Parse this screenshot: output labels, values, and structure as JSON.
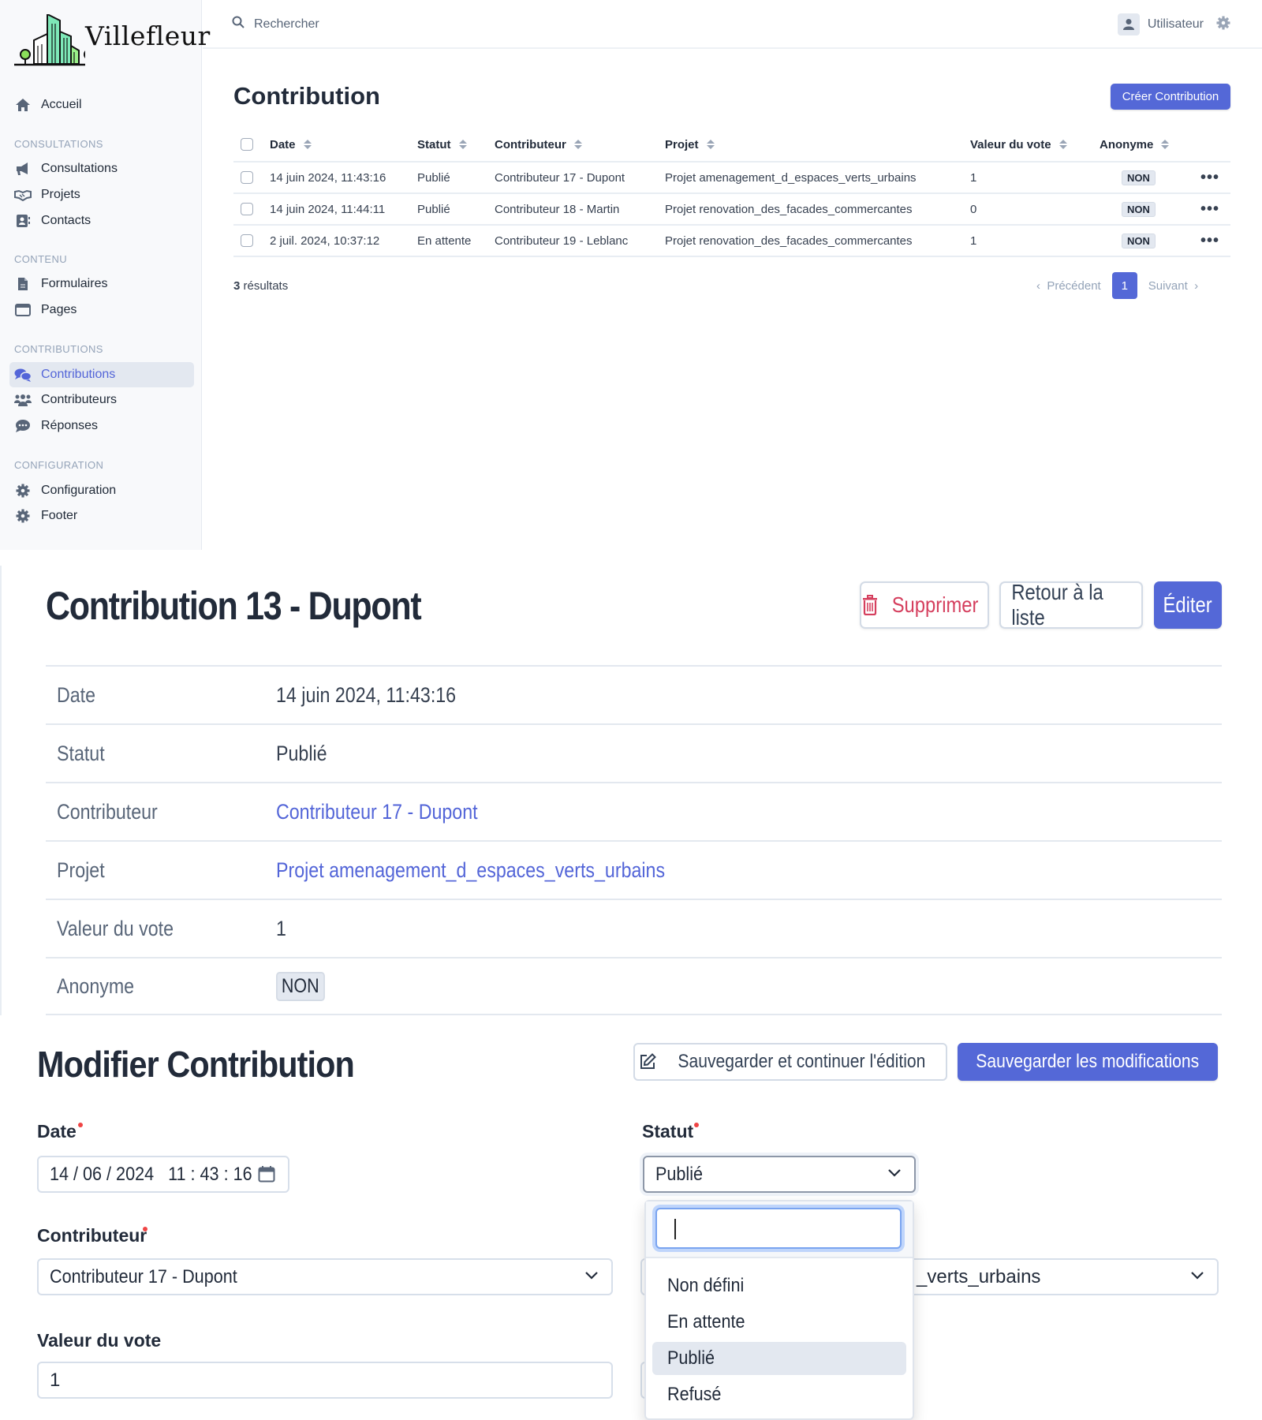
{
  "app": {
    "brand": "Villefleur",
    "search_placeholder": "Rechercher",
    "user_label": "Utilisateur"
  },
  "sidebar": {
    "home": {
      "label": "Accueil",
      "icon": "home-icon"
    },
    "sections": [
      {
        "title": "CONSULTATIONS",
        "items": [
          {
            "label": "Consultations",
            "icon": "megaphone-icon"
          },
          {
            "label": "Projets",
            "icon": "handshake-icon"
          },
          {
            "label": "Contacts",
            "icon": "address-book-icon"
          }
        ]
      },
      {
        "title": "CONTENU",
        "items": [
          {
            "label": "Formulaires",
            "icon": "file-icon"
          },
          {
            "label": "Pages",
            "icon": "window-icon"
          }
        ]
      },
      {
        "title": "CONTRIBUTIONS",
        "items": [
          {
            "label": "Contributions",
            "icon": "comments-icon",
            "active": true
          },
          {
            "label": "Contributeurs",
            "icon": "users-icon"
          },
          {
            "label": "Réponses",
            "icon": "comment-dots-icon"
          }
        ]
      },
      {
        "title": "CONFIGURATION",
        "items": [
          {
            "label": "Configuration",
            "icon": "gear-icon"
          },
          {
            "label": "Footer",
            "icon": "gear-icon"
          }
        ]
      }
    ]
  },
  "list": {
    "title": "Contribution",
    "create_button": "Créer Contribution",
    "columns": [
      "Date",
      "Statut",
      "Contributeur",
      "Projet",
      "Valeur du vote",
      "Anonyme"
    ],
    "rows": [
      {
        "date": "14 juin 2024, 11:43:16",
        "statut": "Publié",
        "contributeur": "Contributeur 17 - Dupont",
        "projet": "Projet amenagement_d_espaces_verts_urbains",
        "vote": "1",
        "anonyme": "NON"
      },
      {
        "date": "14 juin 2024, 11:44:11",
        "statut": "Publié",
        "contributeur": "Contributeur 18 - Martin",
        "projet": "Projet renovation_des_facades_commercantes",
        "vote": "0",
        "anonyme": "NON"
      },
      {
        "date": "2 juil. 2024, 10:37:12",
        "statut": "En attente",
        "contributeur": "Contributeur 19 - Leblanc",
        "projet": "Projet renovation_des_facades_commercantes",
        "vote": "1",
        "anonyme": "NON"
      }
    ],
    "results_count": "3",
    "results_label": " résultats",
    "pagination": {
      "prev": "Précédent",
      "current": "1",
      "next": "Suivant"
    }
  },
  "detail": {
    "title": "Contribution 13 - Dupont",
    "delete_button": "Supprimer",
    "back_button": "Retour à la liste",
    "edit_button": "Éditer",
    "fields": [
      {
        "label": "Date",
        "value": "14 juin 2024, 11:43:16"
      },
      {
        "label": "Statut",
        "value": "Publié"
      },
      {
        "label": "Contributeur",
        "value": "Contributeur 17 - Dupont"
      },
      {
        "label": "Projet",
        "value": "Projet amenagement_d_espaces_verts_urbains"
      },
      {
        "label": "Valeur du vote",
        "value": "1"
      },
      {
        "label": "Anonyme",
        "value": "NON"
      }
    ]
  },
  "edit": {
    "title": "Modifier Contribution",
    "save_continue_button": "Sauvegarder et continuer l'édition",
    "save_button": "Sauvegarder les modifications",
    "date_label": "Date",
    "date_value": "14 / 06 / 2024   11 : 43 : 16",
    "statut_label": "Statut",
    "statut_value": "Publié",
    "statut_search_value": "",
    "statut_options": [
      "Non défini",
      "En attente",
      "Publié",
      "Refusé"
    ],
    "statut_selected_index": 2,
    "contributeur_label": "Contributeur",
    "contributeur_value": "Contributeur 17 - Dupont",
    "projet_value_visible": "_verts_urbains",
    "vote_label": "Valeur du vote",
    "vote_value": "1"
  },
  "colors": {
    "accent": "#5468d7",
    "link": "#5365d8",
    "danger": "#d53f5e",
    "sidebar_bg": "#f8f9fb",
    "required_dot": "#ef4444"
  }
}
